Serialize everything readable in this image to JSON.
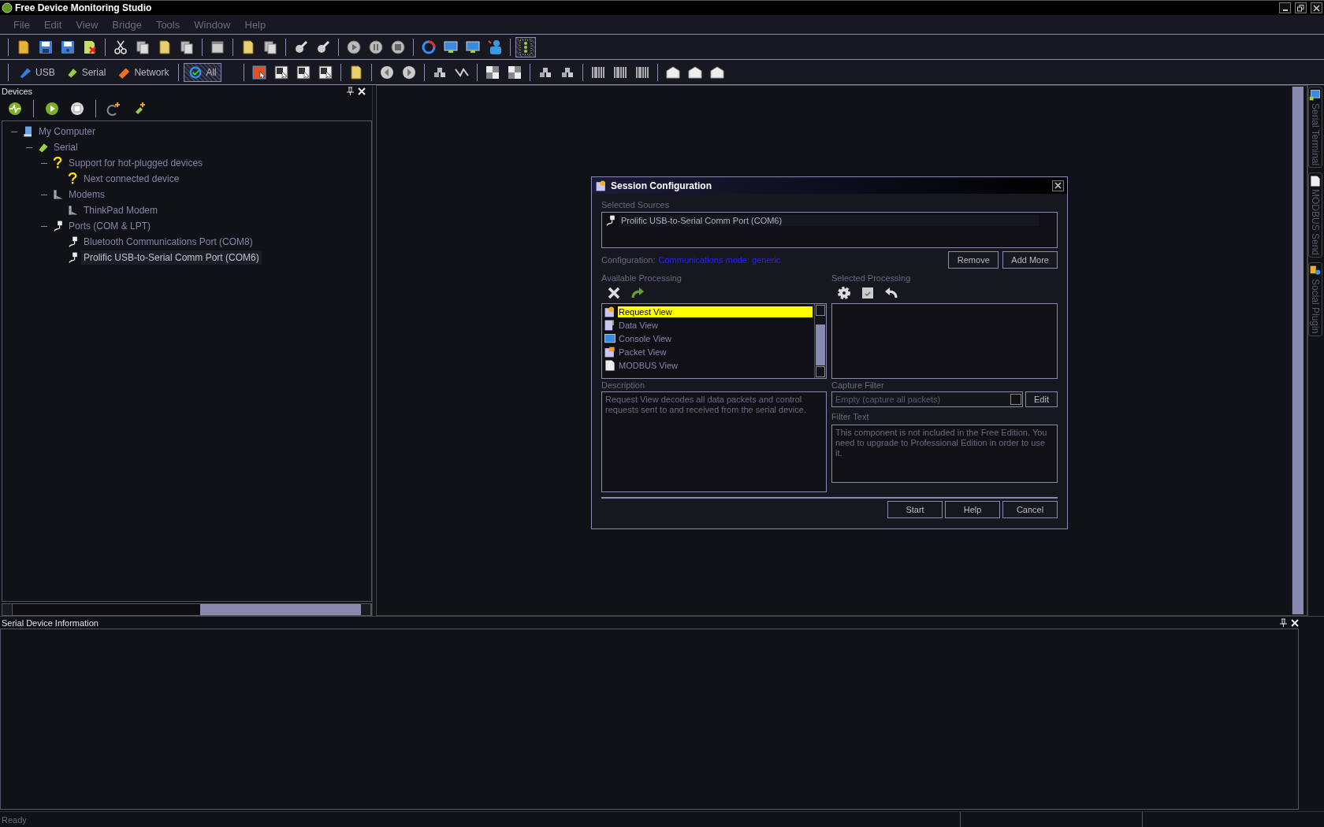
{
  "window": {
    "title": "Free Device Monitoring Studio"
  },
  "menu": [
    "File",
    "Edit",
    "View",
    "Bridge",
    "Tools",
    "Window",
    "Help"
  ],
  "main_toolbar": {
    "grid_toggle_on": true
  },
  "source_tabs": [
    {
      "label": "USB",
      "kind": "usb",
      "selected": false
    },
    {
      "label": "Serial",
      "kind": "serial",
      "selected": false
    },
    {
      "label": "Network",
      "kind": "network",
      "selected": false
    },
    {
      "label": "All",
      "kind": "all",
      "selected": true
    }
  ],
  "devices_panel": {
    "title": "Devices",
    "tree": [
      {
        "label": "My Computer",
        "kind": "computer",
        "expanded": true,
        "selected": false,
        "children": [
          {
            "label": "Serial",
            "kind": "serial",
            "expanded": true,
            "selected": false,
            "children": [
              {
                "label": "Support for hot-plugged devices",
                "kind": "unknown",
                "expanded": true,
                "selected": false,
                "children": [
                  {
                    "label": "Next connected device",
                    "kind": "unknown",
                    "selected": false
                  }
                ]
              },
              {
                "label": "Modems",
                "kind": "modem",
                "expanded": true,
                "selected": false,
                "children": [
                  {
                    "label": "ThinkPad Modem",
                    "kind": "modem",
                    "selected": false
                  }
                ]
              },
              {
                "label": "Ports (COM & LPT)",
                "kind": "port",
                "expanded": true,
                "selected": false,
                "children": [
                  {
                    "label": "Bluetooth Communications Port (COM8)",
                    "kind": "port",
                    "selected": false
                  },
                  {
                    "label": "Prolific USB-to-Serial Comm Port (COM6)",
                    "kind": "port",
                    "selected": true
                  }
                ]
              }
            ]
          }
        ]
      }
    ]
  },
  "dialog": {
    "title": "Session Configuration",
    "selected_sources_label": "Selected Sources",
    "selected_sources": [
      "Prolific USB-to-Serial Comm Port (COM6)"
    ],
    "configuration_label": "Configuration:",
    "configuration_link": "Communications mode: generic",
    "remove_button": "Remove",
    "add_more_button": "Add More",
    "available_label": "Available Processing",
    "available": [
      {
        "label": "Request View",
        "kind": "request",
        "selected": true
      },
      {
        "label": "Data View",
        "kind": "data",
        "selected": false
      },
      {
        "label": "Console View",
        "kind": "console",
        "selected": false
      },
      {
        "label": "Packet View",
        "kind": "packet",
        "selected": false
      },
      {
        "label": "MODBUS View",
        "kind": "modbus",
        "selected": false
      }
    ],
    "selected_processing_label": "Selected Processing",
    "description_label": "Description",
    "description": "Request View decodes all data packets and control requests sent to and received from the serial device.",
    "capture_filter_label": "Capture Filter",
    "capture_filter": {
      "placeholder": "Empty (capture all packets)"
    },
    "edit_button": "Edit",
    "filter_text_label": "Filter Text",
    "filter_text": "This component is not included in the Free Edition. You need to upgrade to Professional Edition in order to use it.",
    "buttons": [
      "Start",
      "Help",
      "Cancel"
    ]
  },
  "side_tabs": [
    {
      "label": "Serial Terminal",
      "kind": "terminal"
    },
    {
      "label": "MODBUS Send",
      "kind": "modbus"
    },
    {
      "label": "Social Plugin",
      "kind": "social"
    }
  ],
  "info_panel": {
    "title": "Serial Device Information"
  },
  "status_bar": {
    "text": "Ready"
  }
}
